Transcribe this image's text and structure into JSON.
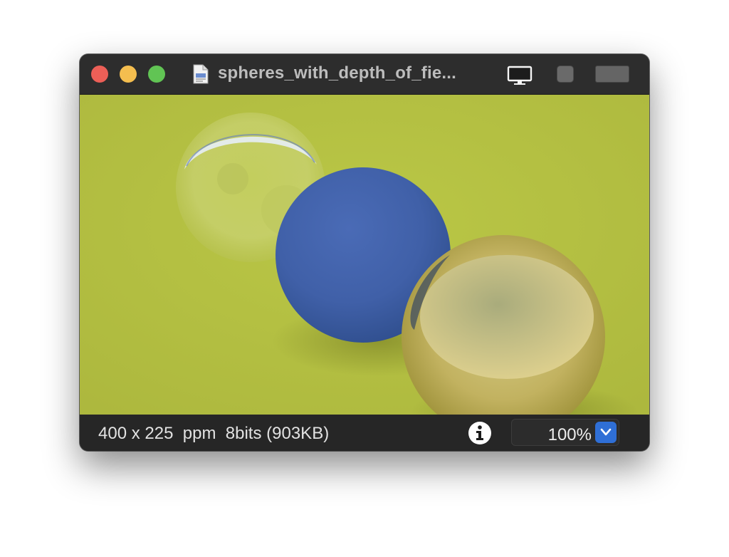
{
  "window": {
    "title": "spheres_with_depth_of_fie...",
    "controls": [
      "close",
      "minimize",
      "zoom"
    ]
  },
  "titlebar": {
    "icons": [
      "document-icon",
      "monitor-icon",
      "toggle-square-button",
      "window-size-button"
    ]
  },
  "image": {
    "description_icon": "rendered-image",
    "background_color": "#b6c043"
  },
  "statusbar": {
    "info_text": "400 x 225  ppm  8bits (903KB)",
    "info_icon": "info-icon",
    "zoom_value": "100%"
  },
  "colors": {
    "accent": "#2f6fd6",
    "close": "#ec5f57",
    "minimize": "#f4be4f",
    "zoom": "#61c454"
  }
}
